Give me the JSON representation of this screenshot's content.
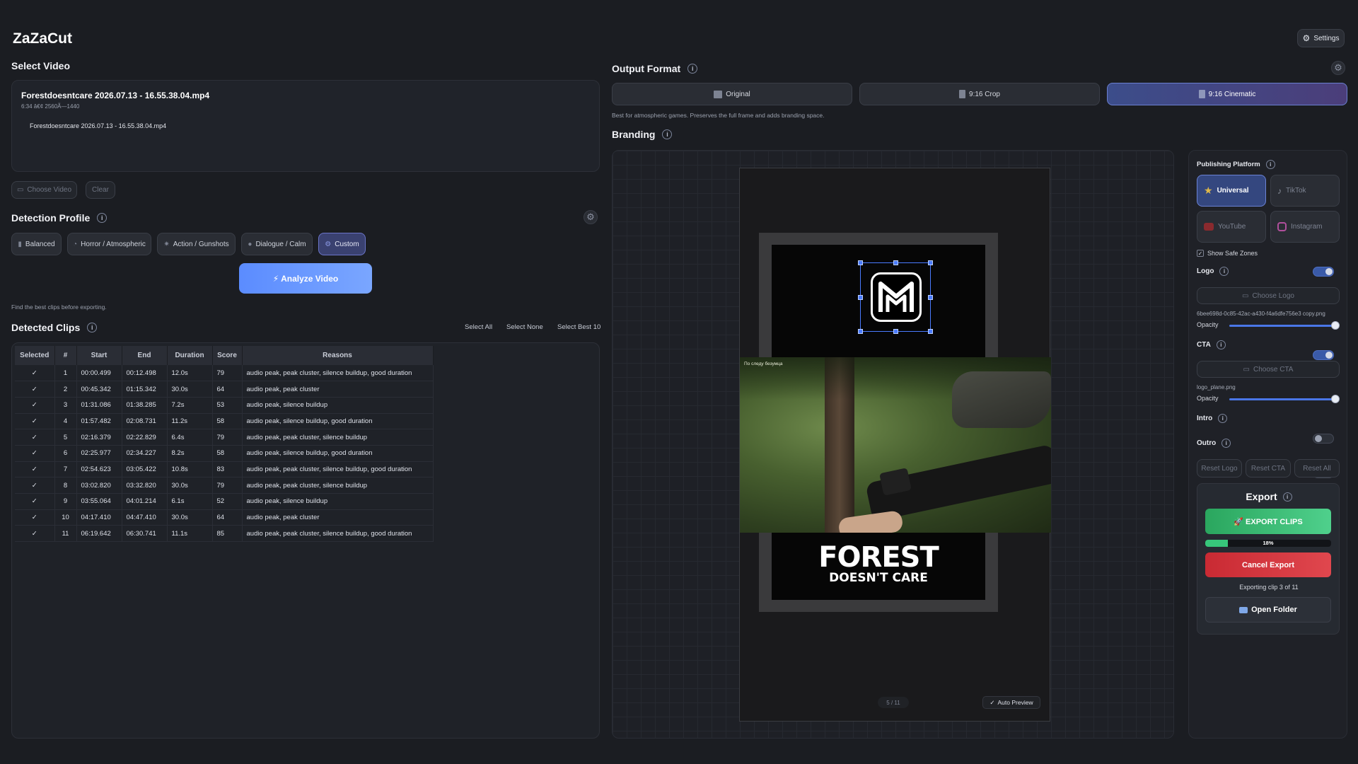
{
  "app": {
    "title": "ZaZaCut",
    "settings_label": "Settings"
  },
  "select_video": {
    "title": "Select Video",
    "file_name": "Forestdoesntcare 2026.07.13 - 16.55.38.04.mp4",
    "file_meta": "6:34 â€¢ 2560Ã—1440",
    "list_item": "Forestdoesntcare 2026.07.13 - 16.55.38.04.mp4",
    "choose_label": "Choose Video",
    "clear_label": "Clear"
  },
  "detection": {
    "title": "Detection Profile",
    "profiles": [
      {
        "label": "Balanced",
        "icon": "bar-chart-icon"
      },
      {
        "label": "Horror / Atmospheric",
        "icon": "ghost-icon"
      },
      {
        "label": "Action / Gunshots",
        "icon": "burst-icon"
      },
      {
        "label": "Dialogue / Calm",
        "icon": "speech-icon"
      },
      {
        "label": "Custom",
        "icon": "gear-icon"
      }
    ],
    "active": "Custom",
    "analyze_label": "⚡ Analyze Video",
    "hint": "Find the best clips before exporting."
  },
  "clips": {
    "title": "Detected Clips",
    "select_all": "Select All",
    "select_none": "Select None",
    "select_best": "Select Best 10",
    "columns": [
      "Selected",
      "#",
      "Start",
      "End",
      "Duration",
      "Score",
      "Reasons"
    ],
    "rows": [
      [
        "✓",
        "1",
        "00:00.499",
        "00:12.498",
        "12.0s",
        "79",
        "audio peak, peak cluster, silence buildup, good duration"
      ],
      [
        "✓",
        "2",
        "00:45.342",
        "01:15.342",
        "30.0s",
        "64",
        "audio peak, peak cluster"
      ],
      [
        "✓",
        "3",
        "01:31.086",
        "01:38.285",
        "7.2s",
        "53",
        "audio peak, silence buildup"
      ],
      [
        "✓",
        "4",
        "01:57.482",
        "02:08.731",
        "11.2s",
        "58",
        "audio peak, silence buildup, good duration"
      ],
      [
        "✓",
        "5",
        "02:16.379",
        "02:22.829",
        "6.4s",
        "79",
        "audio peak, peak cluster, silence buildup"
      ],
      [
        "✓",
        "6",
        "02:25.977",
        "02:34.227",
        "8.2s",
        "58",
        "audio peak, silence buildup, good duration"
      ],
      [
        "✓",
        "7",
        "02:54.623",
        "03:05.422",
        "10.8s",
        "83",
        "audio peak, peak cluster, silence buildup, good duration"
      ],
      [
        "✓",
        "8",
        "03:02.820",
        "03:32.820",
        "30.0s",
        "79",
        "audio peak, peak cluster, silence buildup"
      ],
      [
        "✓",
        "9",
        "03:55.064",
        "04:01.214",
        "6.1s",
        "52",
        "audio peak, silence buildup"
      ],
      [
        "✓",
        "10",
        "04:17.410",
        "04:47.410",
        "30.0s",
        "64",
        "audio peak, peak cluster"
      ],
      [
        "✓",
        "11",
        "06:19.642",
        "06:30.741",
        "11.1s",
        "85",
        "audio peak, peak cluster, silence buildup, good duration"
      ]
    ]
  },
  "output_format": {
    "title": "Output Format",
    "options": [
      "Original",
      "9:16 Crop",
      "9:16 Cinematic"
    ],
    "active": "9:16 Cinematic",
    "description": "Best for atmospheric games. Preserves the full frame and adds branding space."
  },
  "branding": {
    "title": "Branding",
    "preview_counter": "5 / 11",
    "auto_preview": "Auto Preview",
    "game_logo_line1": "FOREST",
    "game_logo_line2": "DOESN'T CARE",
    "video_hud": "По следу безумца"
  },
  "publishing": {
    "title": "Publishing Platform",
    "platforms": [
      {
        "label": "Universal",
        "icon": "star-icon",
        "active": true
      },
      {
        "label": "TikTok",
        "icon": "tiktok-icon",
        "active": false
      },
      {
        "label": "YouTube",
        "icon": "youtube-icon",
        "active": false
      },
      {
        "label": "Instagram",
        "icon": "instagram-icon",
        "active": false
      }
    ],
    "show_safe_zones": "Show Safe Zones",
    "logo_label": "Logo",
    "logo_enabled": true,
    "choose_logo": "Choose Logo",
    "logo_file": "6bee698d-0c85-42ac-a430-f4a6dfe756e3 copy.png",
    "opacity_label": "Opacity",
    "logo_opacity": 1.0,
    "cta_label": "CTA",
    "cta_enabled": true,
    "choose_cta": "Choose CTA",
    "cta_file": "logo_plane.png",
    "cta_opacity": 1.0,
    "intro_label": "Intro",
    "intro_enabled": false,
    "outro_label": "Outro",
    "outro_enabled": false,
    "reset_logo": "Reset Logo",
    "reset_cta": "Reset CTA",
    "reset_all": "Reset All"
  },
  "export": {
    "title": "Export",
    "export_clips": "🚀 EXPORT CLIPS",
    "progress_text": "18%",
    "progress": 0.18,
    "cancel": "Cancel Export",
    "status": "Exporting clip 3 of 11",
    "open_folder": "Open Folder"
  },
  "colors": {
    "accent": "#4a7bff",
    "export_green": "#2fb86a",
    "cancel_red": "#d8343c",
    "background": "#1b1d22"
  }
}
